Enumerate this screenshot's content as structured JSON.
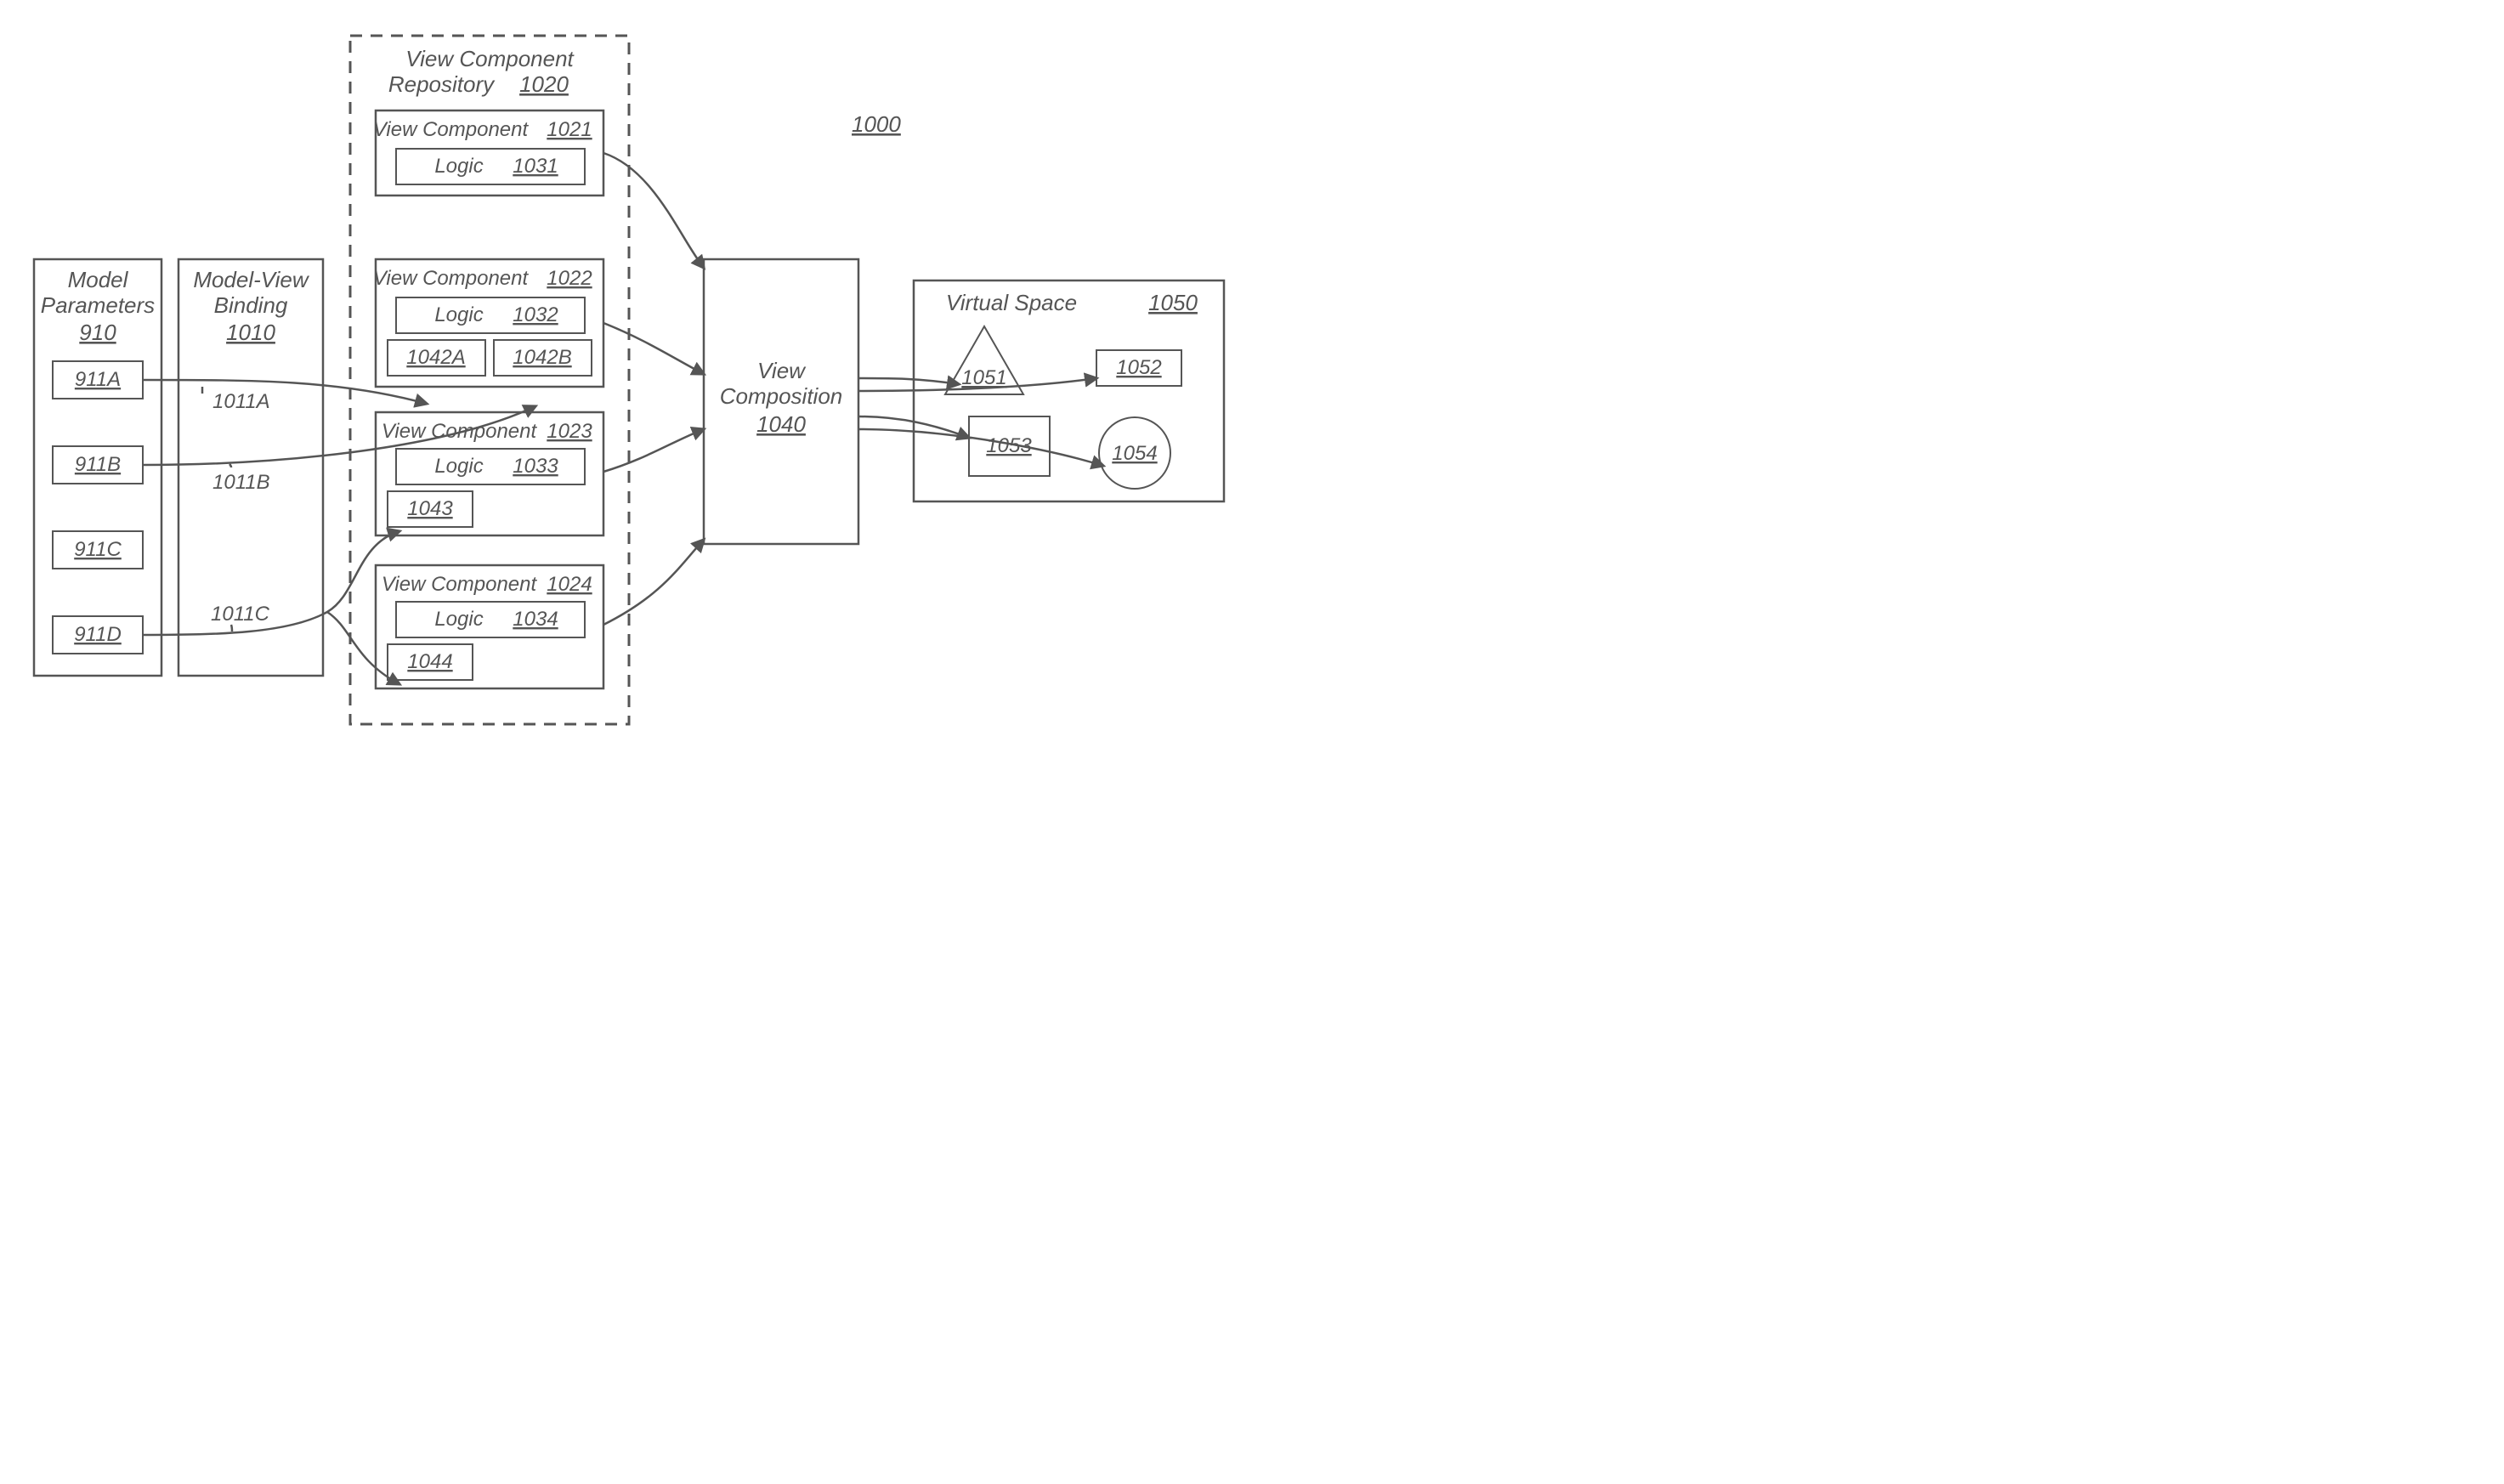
{
  "figureId": "1000",
  "modelParameters": {
    "title": "Model",
    "subtitle": "Parameters",
    "ref": "910",
    "items": [
      "911A",
      "911B",
      "911C",
      "911D"
    ]
  },
  "modelViewBinding": {
    "title": "Model-View",
    "subtitle": "Binding",
    "ref": "1010",
    "bindings": [
      "1011A",
      "1011B",
      "1011C"
    ]
  },
  "repository": {
    "title": "View Component",
    "subtitle": "Repository",
    "ref": "1020",
    "components": [
      {
        "name": "View Component",
        "ref": "1021",
        "logicLabel": "Logic",
        "logicRef": "1031",
        "inputs": []
      },
      {
        "name": "View Component",
        "ref": "1022",
        "logicLabel": "Logic",
        "logicRef": "1032",
        "inputs": [
          "1042A",
          "1042B"
        ]
      },
      {
        "name": "View Component",
        "ref": "1023",
        "logicLabel": "Logic",
        "logicRef": "1033",
        "inputs": [
          "1043"
        ]
      },
      {
        "name": "View Component",
        "ref": "1024",
        "logicLabel": "Logic",
        "logicRef": "1034",
        "inputs": [
          "1044"
        ]
      }
    ]
  },
  "viewComposition": {
    "title": "View",
    "subtitle": "Composition",
    "ref": "1040"
  },
  "virtualSpace": {
    "title": "Virtual Space",
    "ref": "1050",
    "shapes": {
      "triangle": "1051",
      "rect": "1052",
      "tallRect": "1053",
      "circle": "1054"
    }
  }
}
